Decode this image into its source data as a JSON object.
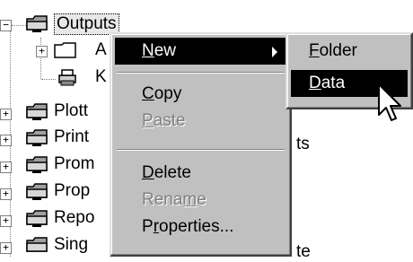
{
  "tree": {
    "items": [
      {
        "label": "Outputs",
        "expander": "−"
      },
      {
        "label": "A",
        "expander": "+"
      },
      {
        "label": "K",
        "expander": ""
      },
      {
        "label": "Plott",
        "expander": "+"
      },
      {
        "label": "Print",
        "expander": "+",
        "trailing": "ts"
      },
      {
        "label": "Prom",
        "expander": "+"
      },
      {
        "label": "Prop",
        "expander": "+"
      },
      {
        "label": "Repo",
        "expander": "+"
      },
      {
        "label": "Sing",
        "expander": "+",
        "trailing": "te"
      }
    ]
  },
  "context_menu": {
    "items": [
      {
        "label": "New",
        "accel": "N",
        "rest": "ew",
        "highlighted": true,
        "has_submenu": true
      },
      {
        "label": "Copy",
        "accel": "C",
        "rest": "opy"
      },
      {
        "label": "Paste",
        "accel": "P",
        "rest": "aste",
        "disabled": true
      },
      {
        "label": "Delete",
        "accel": "D",
        "rest": "elete"
      },
      {
        "label": "Rename",
        "pre": "Rena",
        "accel": "m",
        "rest": "e",
        "disabled": true
      },
      {
        "label": "Properties...",
        "pre": "P",
        "accel": "r",
        "rest": "operties..."
      }
    ]
  },
  "submenu": {
    "items": [
      {
        "label": "Folder",
        "accel": "F",
        "rest": "older"
      },
      {
        "label": "Data",
        "accel": "D",
        "rest": "ata",
        "highlighted": true
      }
    ]
  },
  "colors": {
    "menu_bg": "#c0c0c0",
    "highlight_bg": "#000000",
    "highlight_fg": "#ffffff",
    "disabled": "#808080"
  }
}
